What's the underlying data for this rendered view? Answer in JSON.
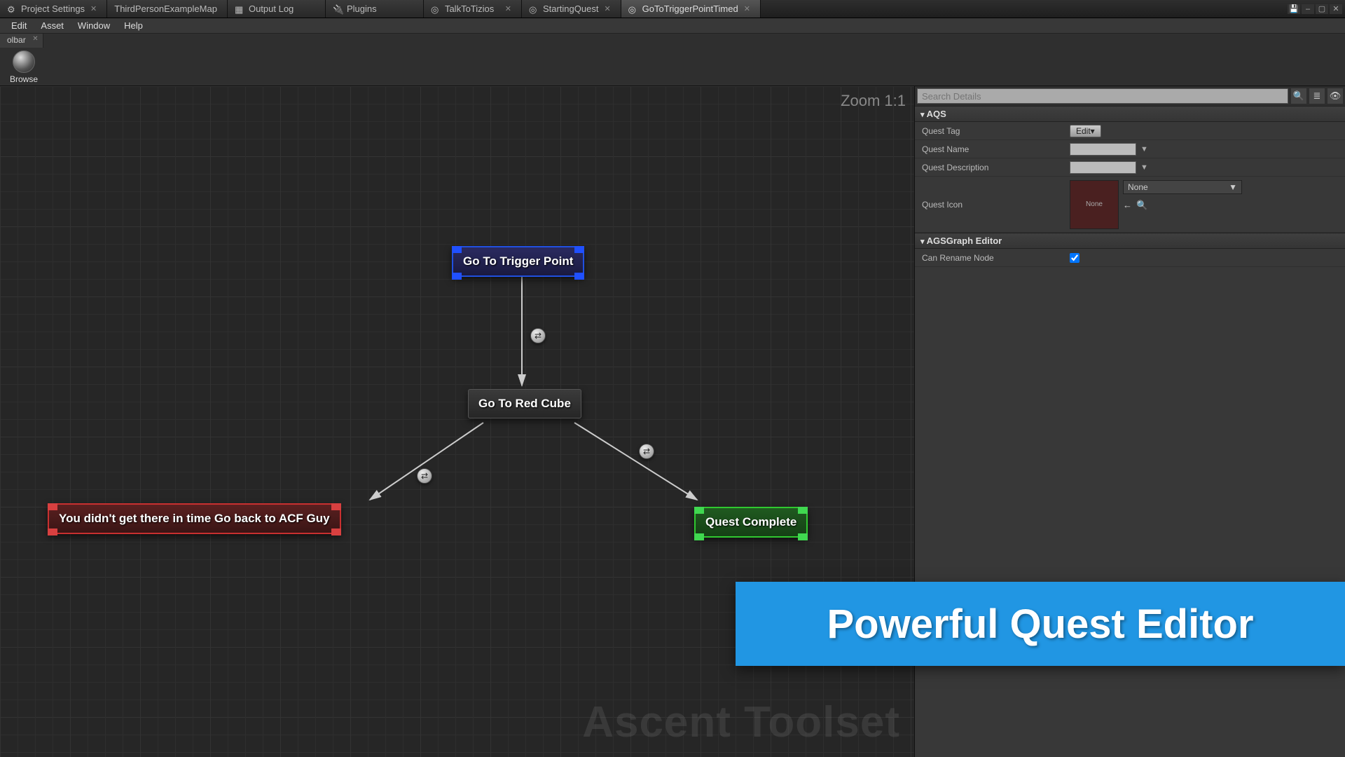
{
  "tabs": [
    {
      "label": "Project Settings"
    },
    {
      "label": "ThirdPersonExampleMap"
    },
    {
      "label": "Output Log"
    },
    {
      "label": "Plugins"
    },
    {
      "label": "TalkToTizios"
    },
    {
      "label": "StartingQuest"
    },
    {
      "label": "GoToTriggerPointTimed"
    }
  ],
  "menubar": [
    "Edit",
    "Asset",
    "Window",
    "Help"
  ],
  "toolbar": {
    "tab": "olbar",
    "browse": "Browse"
  },
  "graph": {
    "zoom": "Zoom 1:1",
    "watermark": "Ascent Toolset",
    "nodes": {
      "start": "Go To Trigger Point",
      "mid": "Go To Red Cube",
      "fail": "You didn't get there in time Go back to ACF Guy",
      "done": "Quest Complete"
    }
  },
  "details": {
    "search_placeholder": "Search Details",
    "cat1": "AQS",
    "quest_tag_label": "Quest Tag",
    "quest_tag_btn": "Edit▾",
    "quest_name_label": "Quest Name",
    "quest_desc_label": "Quest Description",
    "quest_icon_label": "Quest Icon",
    "icon_preview": "None",
    "icon_dropdown": "None",
    "cat2": "AGSGraph Editor",
    "rename_label": "Can Rename Node"
  },
  "banner": "Powerful Quest Editor"
}
